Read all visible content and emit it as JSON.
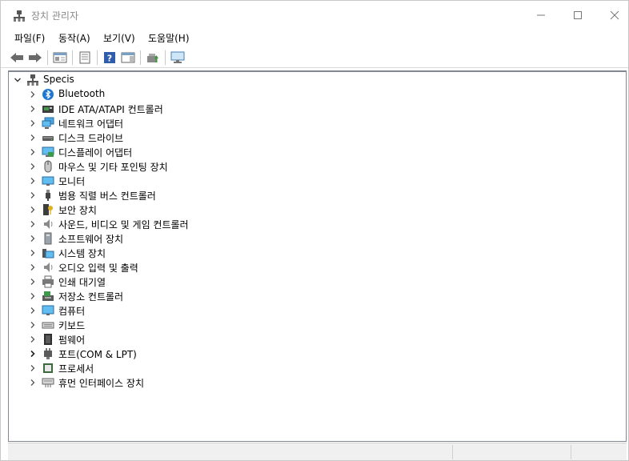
{
  "window": {
    "title": "장치 관리자"
  },
  "menu": [
    "파일(F)",
    "동작(A)",
    "보기(V)",
    "도움말(H)"
  ],
  "toolbar": [
    "back-icon",
    "forward-icon",
    "show-hide-console-tree-icon",
    "properties-icon",
    "help-icon",
    "action-pane-icon",
    "update-driver-icon",
    "scan-hardware-icon"
  ],
  "tree": {
    "root": "Specis",
    "items": [
      {
        "label": "Bluetooth",
        "icon": "bluetooth-icon"
      },
      {
        "label": "IDE ATA/ATAPI 컨트롤러",
        "icon": "ide-controller-icon"
      },
      {
        "label": "네트워크 어댑터",
        "icon": "network-adapter-icon"
      },
      {
        "label": "디스크 드라이브",
        "icon": "disk-drive-icon"
      },
      {
        "label": "디스플레이 어댑터",
        "icon": "display-adapter-icon"
      },
      {
        "label": "마우스 및 기타 포인팅 장치",
        "icon": "mouse-icon"
      },
      {
        "label": "모니터",
        "icon": "monitor-icon"
      },
      {
        "label": "범용 직렬 버스 컨트롤러",
        "icon": "usb-icon"
      },
      {
        "label": "보안 장치",
        "icon": "security-device-icon"
      },
      {
        "label": "사운드, 비디오 및 게임 컨트롤러",
        "icon": "sound-icon"
      },
      {
        "label": "소프트웨어 장치",
        "icon": "software-device-icon"
      },
      {
        "label": "시스템 장치",
        "icon": "system-device-icon"
      },
      {
        "label": "오디오 입력 및 출력",
        "icon": "audio-io-icon"
      },
      {
        "label": "인쇄 대기열",
        "icon": "printer-icon"
      },
      {
        "label": "저장소 컨트롤러",
        "icon": "storage-controller-icon"
      },
      {
        "label": "컴퓨터",
        "icon": "computer-icon"
      },
      {
        "label": "키보드",
        "icon": "keyboard-icon"
      },
      {
        "label": "펌웨어",
        "icon": "firmware-icon"
      },
      {
        "label": "포트(COM & LPT)",
        "icon": "port-icon"
      },
      {
        "label": "프로세서",
        "icon": "processor-icon"
      },
      {
        "label": "휴먼 인터페이스 장치",
        "icon": "hid-icon"
      }
    ]
  }
}
